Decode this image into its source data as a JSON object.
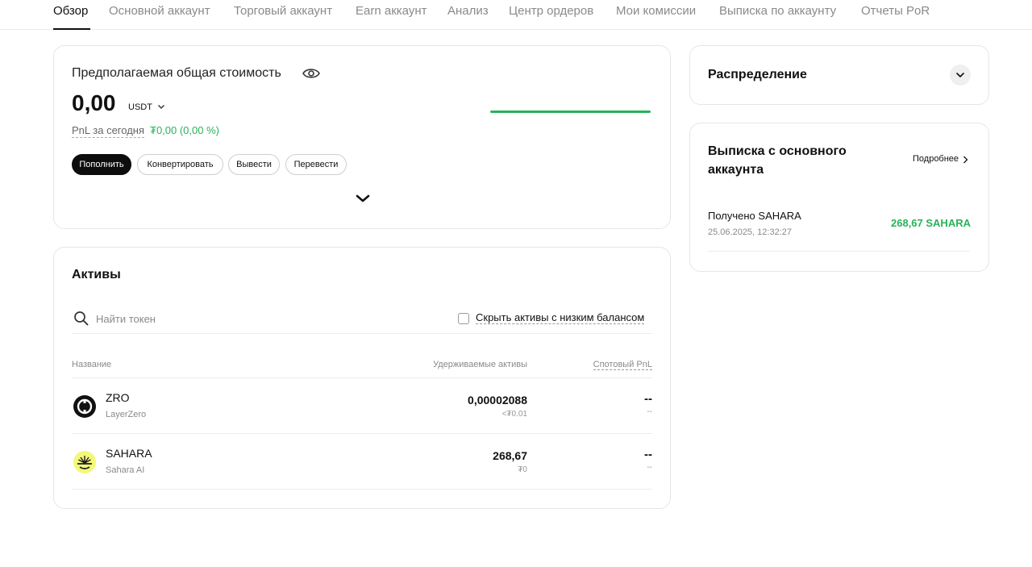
{
  "tabs": [
    {
      "label": "Обзор",
      "active": true
    },
    {
      "label": "Основной аккаунт",
      "active": false
    },
    {
      "label": "Торговый аккаунт",
      "active": false
    },
    {
      "label": "Earn аккаунт",
      "active": false
    },
    {
      "label": "Анализ",
      "active": false
    },
    {
      "label": "Центр ордеров",
      "active": false
    },
    {
      "label": "Мои комиссии",
      "active": false
    },
    {
      "label": "Выписка по аккаунту",
      "active": false
    },
    {
      "label": "Отчеты PoR",
      "active": false
    }
  ],
  "value_card": {
    "title": "Предполагаемая общая стоимость",
    "amount": "0,00",
    "currency": "USDT",
    "pnl_label": "PnL за сегодня",
    "pnl_value": "₮0,00 (0,00 %)",
    "buttons": {
      "deposit": "Пополнить",
      "convert": "Конвертировать",
      "withdraw": "Вывести",
      "transfer": "Перевести"
    }
  },
  "assets": {
    "title": "Активы",
    "search_placeholder": "Найти токен",
    "hide_low_label": "Скрыть активы с низким балансом",
    "columns": {
      "name": "Название",
      "holdings": "Удерживаемые активы",
      "pnl": "Спотовый PnL"
    },
    "rows": [
      {
        "symbol": "ZRO",
        "name": "LayerZero",
        "amount": "0,00002088",
        "value": "<₮0.01",
        "pnl": "--",
        "pnl_sub": "--"
      },
      {
        "symbol": "SAHARA",
        "name": "Sahara AI",
        "amount": "268,67",
        "value": "₮0",
        "pnl": "--",
        "pnl_sub": "--"
      }
    ]
  },
  "distribution": {
    "title": "Распределение"
  },
  "statement": {
    "title": "Выписка с основного аккаунта",
    "more_label": "Подробнее",
    "item": {
      "title": "Получено SAHARA",
      "date": "25.06.2025, 12:32:27",
      "amount": "268,67 SAHARA"
    }
  },
  "colors": {
    "positive": "#27b35a",
    "primary_button": "#0d0d0d",
    "muted_text": "#8a8a8a"
  }
}
